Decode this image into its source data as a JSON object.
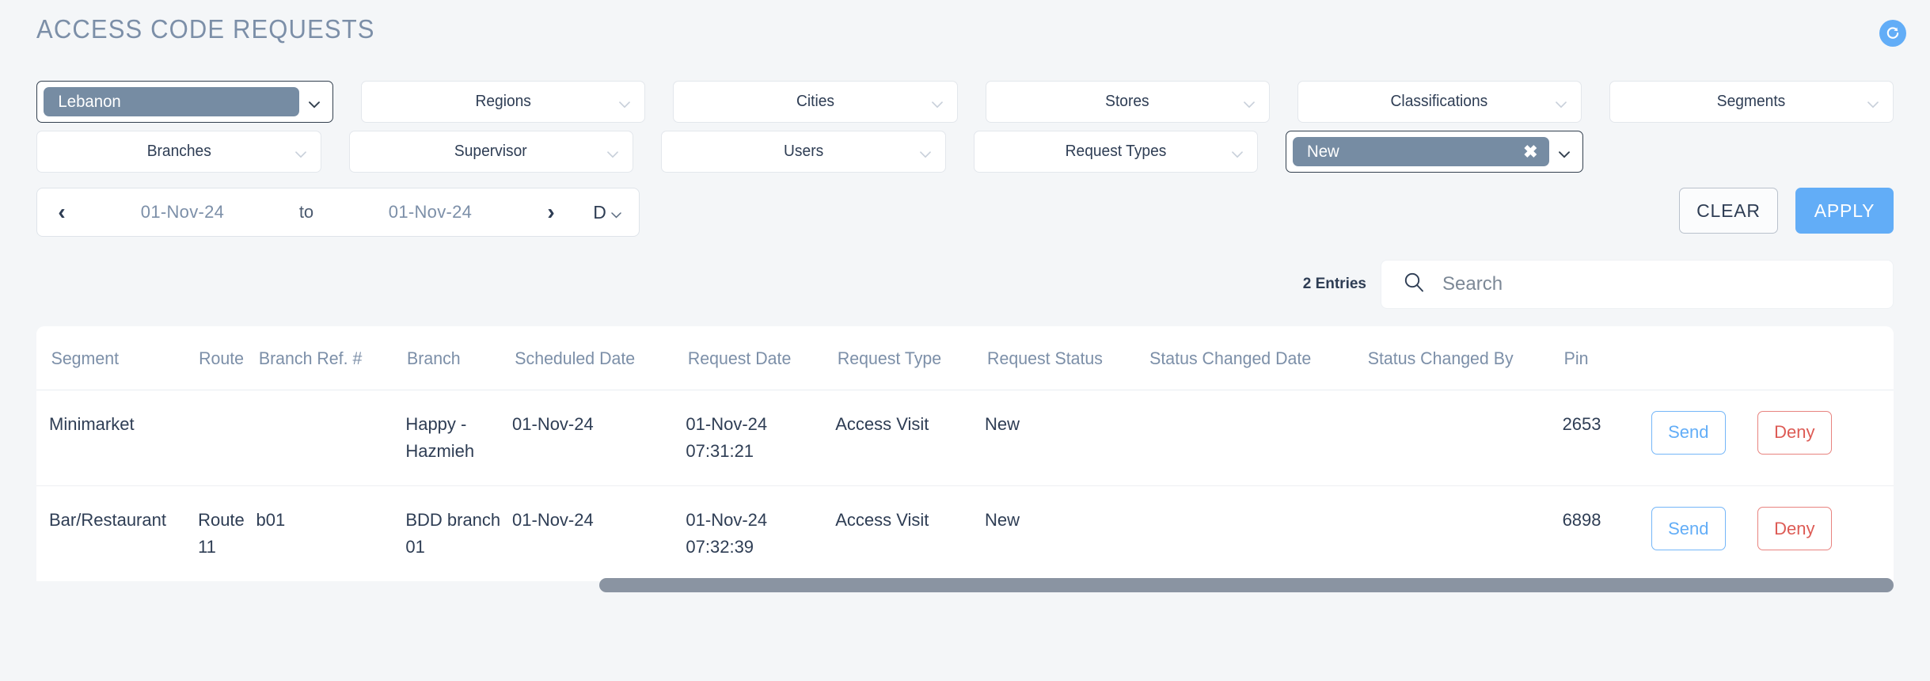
{
  "header": {
    "title": "ACCESS CODE REQUESTS",
    "refresh_icon": "refresh-icon"
  },
  "filters": {
    "row1": [
      {
        "label": "Lebanon",
        "selected": true,
        "removable": false
      },
      {
        "label": "Regions",
        "selected": false
      },
      {
        "label": "Cities",
        "selected": false
      },
      {
        "label": "Stores",
        "selected": false
      },
      {
        "label": "Classifications",
        "selected": false
      },
      {
        "label": "Segments",
        "selected": false
      }
    ],
    "row2": [
      {
        "label": "Branches",
        "selected": false
      },
      {
        "label": "Supervisor",
        "selected": false
      },
      {
        "label": "Users",
        "selected": false
      },
      {
        "label": "Request Types",
        "selected": false
      },
      {
        "label": "New",
        "selected": true,
        "removable": true
      }
    ]
  },
  "date_range": {
    "prev_icon": "chevron-left-icon",
    "next_icon": "chevron-right-icon",
    "from": "01-Nov-24",
    "separator": "to",
    "to": "01-Nov-24",
    "mode": "D"
  },
  "actions": {
    "clear_label": "CLEAR",
    "apply_label": "APPLY"
  },
  "toolbar": {
    "entries": "2 Entries",
    "search_placeholder": "Search",
    "search_value": ""
  },
  "table": {
    "columns": [
      "Segment",
      "Route",
      "Branch Ref. #",
      "Branch",
      "Scheduled Date",
      "Request Date",
      "Request Type",
      "Request Status",
      "Status Changed Date",
      "Status Changed By",
      "Pin"
    ],
    "rows": [
      {
        "segment": "Minimarket",
        "route": "",
        "branch_ref": "",
        "branch": "Happy - Hazmieh",
        "scheduled_date": "01-Nov-24",
        "request_date": "01-Nov-24 07:31:21",
        "request_type": "Access Visit",
        "request_status": "New",
        "status_changed_date": "",
        "status_changed_by": "",
        "pin": "2653",
        "send_label": "Send",
        "deny_label": "Deny"
      },
      {
        "segment": "Bar/Restaurant",
        "route": "Route 11",
        "branch_ref": "b01",
        "branch": "BDD branch 01",
        "scheduled_date": "01-Nov-24",
        "request_date": "01-Nov-24 07:32:39",
        "request_type": "Access Visit",
        "request_status": "New",
        "status_changed_date": "",
        "status_changed_by": "",
        "pin": "6898",
        "send_label": "Send",
        "deny_label": "Deny"
      }
    ]
  },
  "colors": {
    "accent_blue": "#62adf7",
    "chip_slate": "#768ca3",
    "title_slate": "#7c8fa8",
    "deny_red": "#dd5b55",
    "page_bg": "#f4f6f8"
  }
}
